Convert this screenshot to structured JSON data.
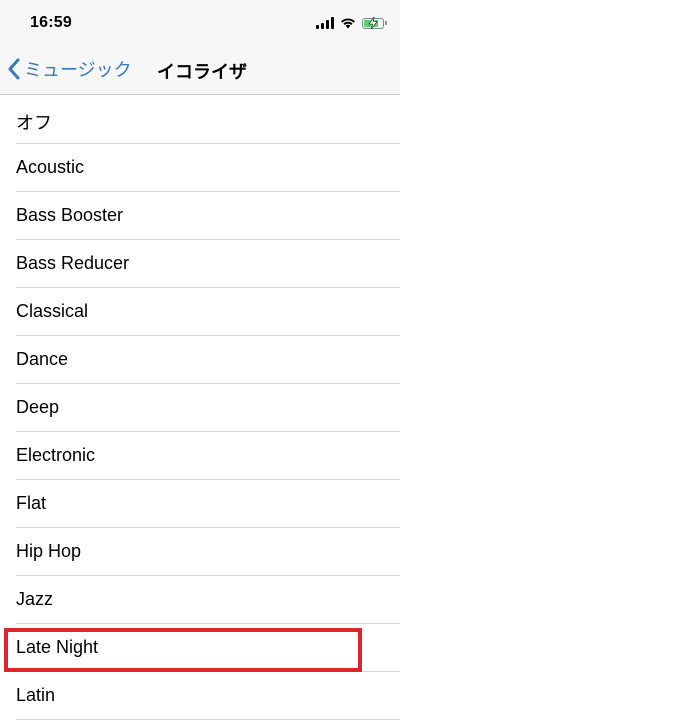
{
  "status_bar": {
    "time": "16:59",
    "icons": [
      "cellular-signal-icon",
      "wifi-icon",
      "battery-charging-icon"
    ],
    "battery_level": 0.8
  },
  "nav": {
    "back_label": "ミュージック",
    "title": "イコライザ"
  },
  "equalizer_options": [
    {
      "label": "オフ"
    },
    {
      "label": "Acoustic"
    },
    {
      "label": "Bass Booster"
    },
    {
      "label": "Bass Reducer"
    },
    {
      "label": "Classical"
    },
    {
      "label": "Dance"
    },
    {
      "label": "Deep"
    },
    {
      "label": "Electronic"
    },
    {
      "label": "Flat"
    },
    {
      "label": "Hip Hop"
    },
    {
      "label": "Jazz"
    },
    {
      "label": "Late Night",
      "highlighted": true
    },
    {
      "label": "Latin"
    }
  ],
  "colors": {
    "accent": "#3478c6",
    "highlight_box": "#e0242b",
    "bar_background": "#f7f7f7",
    "battery": "#4cd964"
  }
}
